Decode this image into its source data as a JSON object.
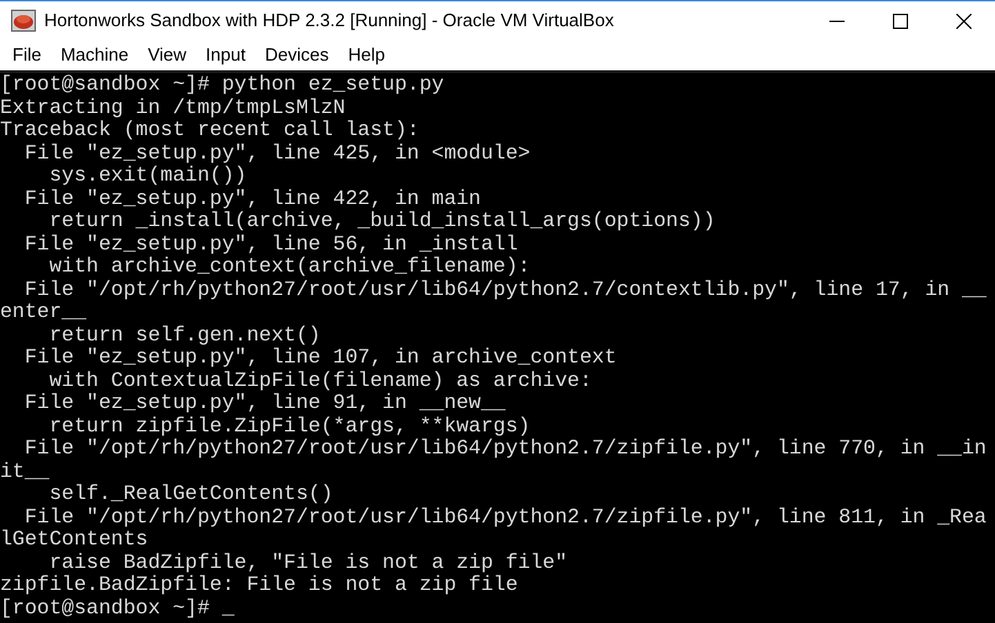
{
  "window": {
    "title": "Hortonworks Sandbox with HDP 2.3.2 [Running] - Oracle VM VirtualBox"
  },
  "menu": [
    "File",
    "Machine",
    "View",
    "Input",
    "Devices",
    "Help"
  ],
  "terminal": {
    "lines": [
      "[root@sandbox ~]# python ez_setup.py",
      "Extracting in /tmp/tmpLsMlzN",
      "Traceback (most recent call last):",
      "  File \"ez_setup.py\", line 425, in <module>",
      "    sys.exit(main())",
      "  File \"ez_setup.py\", line 422, in main",
      "    return _install(archive, _build_install_args(options))",
      "  File \"ez_setup.py\", line 56, in _install",
      "    with archive_context(archive_filename):",
      "  File \"/opt/rh/python27/root/usr/lib64/python2.7/contextlib.py\", line 17, in __",
      "enter__",
      "    return self.gen.next()",
      "  File \"ez_setup.py\", line 107, in archive_context",
      "    with ContextualZipFile(filename) as archive:",
      "  File \"ez_setup.py\", line 91, in __new__",
      "    return zipfile.ZipFile(*args, **kwargs)",
      "  File \"/opt/rh/python27/root/usr/lib64/python2.7/zipfile.py\", line 770, in __in",
      "it__",
      "    self._RealGetContents()",
      "  File \"/opt/rh/python27/root/usr/lib64/python2.7/zipfile.py\", line 811, in _Rea",
      "lGetContents",
      "    raise BadZipfile, \"File is not a zip file\"",
      "zipfile.BadZipfile: File is not a zip file"
    ],
    "prompt": "[root@sandbox ~]#",
    "cursor": "_"
  }
}
